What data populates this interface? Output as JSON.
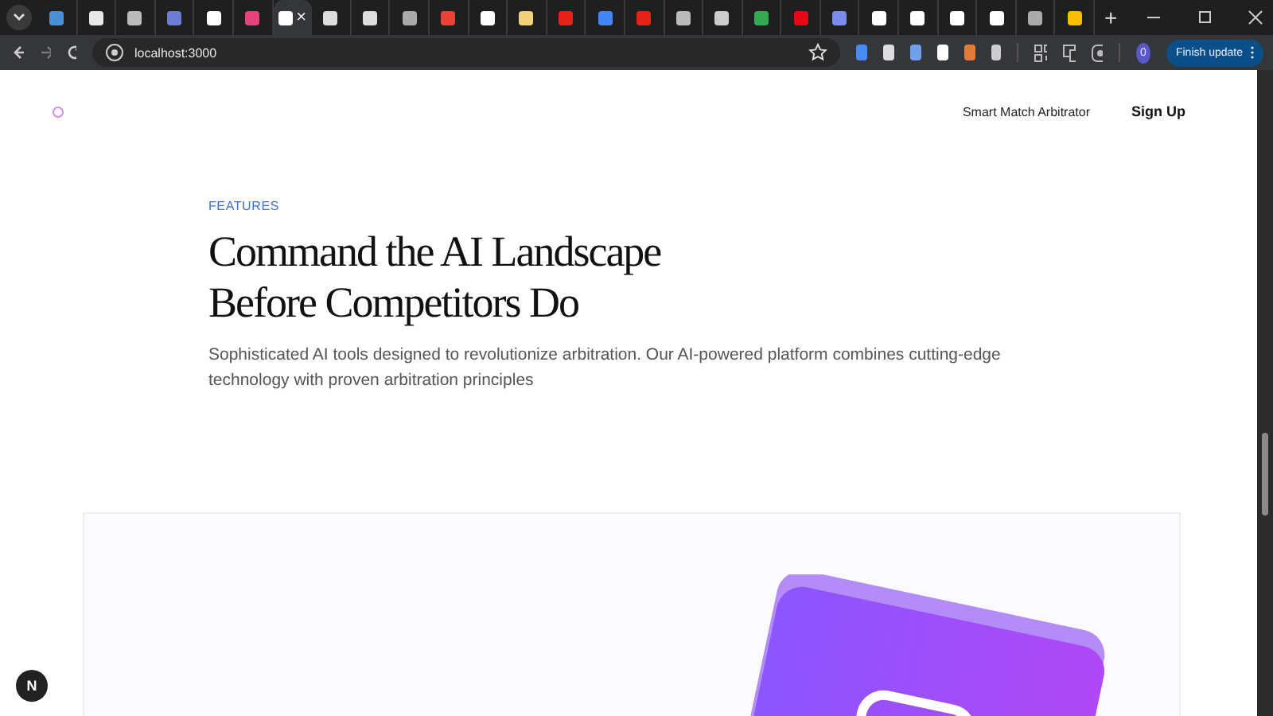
{
  "browser": {
    "tabs": [
      {
        "selected": false,
        "color": "#4a90d9"
      },
      {
        "selected": false,
        "color": "#e8e8e8"
      },
      {
        "selected": false,
        "color": "#bbbbbb"
      },
      {
        "selected": false,
        "color": "#6b7bd6"
      },
      {
        "selected": false,
        "color": "#ffffff"
      },
      {
        "selected": false,
        "color": "#e0457b"
      },
      {
        "selected": true,
        "color": "#ffffff"
      },
      {
        "selected": false,
        "color": "#dddddd"
      },
      {
        "selected": false,
        "color": "#dddddd"
      },
      {
        "selected": false,
        "color": "#aaaaaa"
      },
      {
        "selected": false,
        "color": "#ea4335"
      },
      {
        "selected": false,
        "color": "#ffffff"
      },
      {
        "selected": false,
        "color": "#f1d27a"
      },
      {
        "selected": false,
        "color": "#e62117"
      },
      {
        "selected": false,
        "color": "#4285f4"
      },
      {
        "selected": false,
        "color": "#e62117"
      },
      {
        "selected": false,
        "color": "#bbbbbb"
      },
      {
        "selected": false,
        "color": "#cccccc"
      },
      {
        "selected": false,
        "color": "#34a853"
      },
      {
        "selected": false,
        "color": "#e50914"
      },
      {
        "selected": false,
        "color": "#7b8cf0"
      },
      {
        "selected": false,
        "color": "#ffffff"
      },
      {
        "selected": false,
        "color": "#ffffff"
      },
      {
        "selected": false,
        "color": "#ffffff"
      },
      {
        "selected": false,
        "color": "#ffffff"
      },
      {
        "selected": false,
        "color": "#aaaaaa"
      },
      {
        "selected": false,
        "color": "#fbbc04"
      }
    ],
    "close_tab": "×",
    "new_tab": "+",
    "address": "localhost:3000",
    "extensions": [
      {
        "color": "#4a8af4"
      },
      {
        "color": "#dddddd"
      },
      {
        "color": "#6fa0e8"
      },
      {
        "color": "#ffffff"
      },
      {
        "color": "#e07b39"
      },
      {
        "color": "#cccccc"
      }
    ],
    "profile": "0",
    "update_button": "Finish update"
  },
  "page": {
    "nav": [
      {
        "label": "Smart Match Arbitrator",
        "kind": "link"
      },
      {
        "label": "Sign Up",
        "kind": "cta"
      }
    ],
    "eyebrow": "FEATURES",
    "heading_lines": [
      "Command the AI Landscape",
      "Before Competitors Do"
    ],
    "description": "Sophisticated AI tools designed to revolutionize arbitration. Our AI-powered platform combines cutting-edge technology with proven arbitration principles",
    "dev_badge": "N"
  }
}
